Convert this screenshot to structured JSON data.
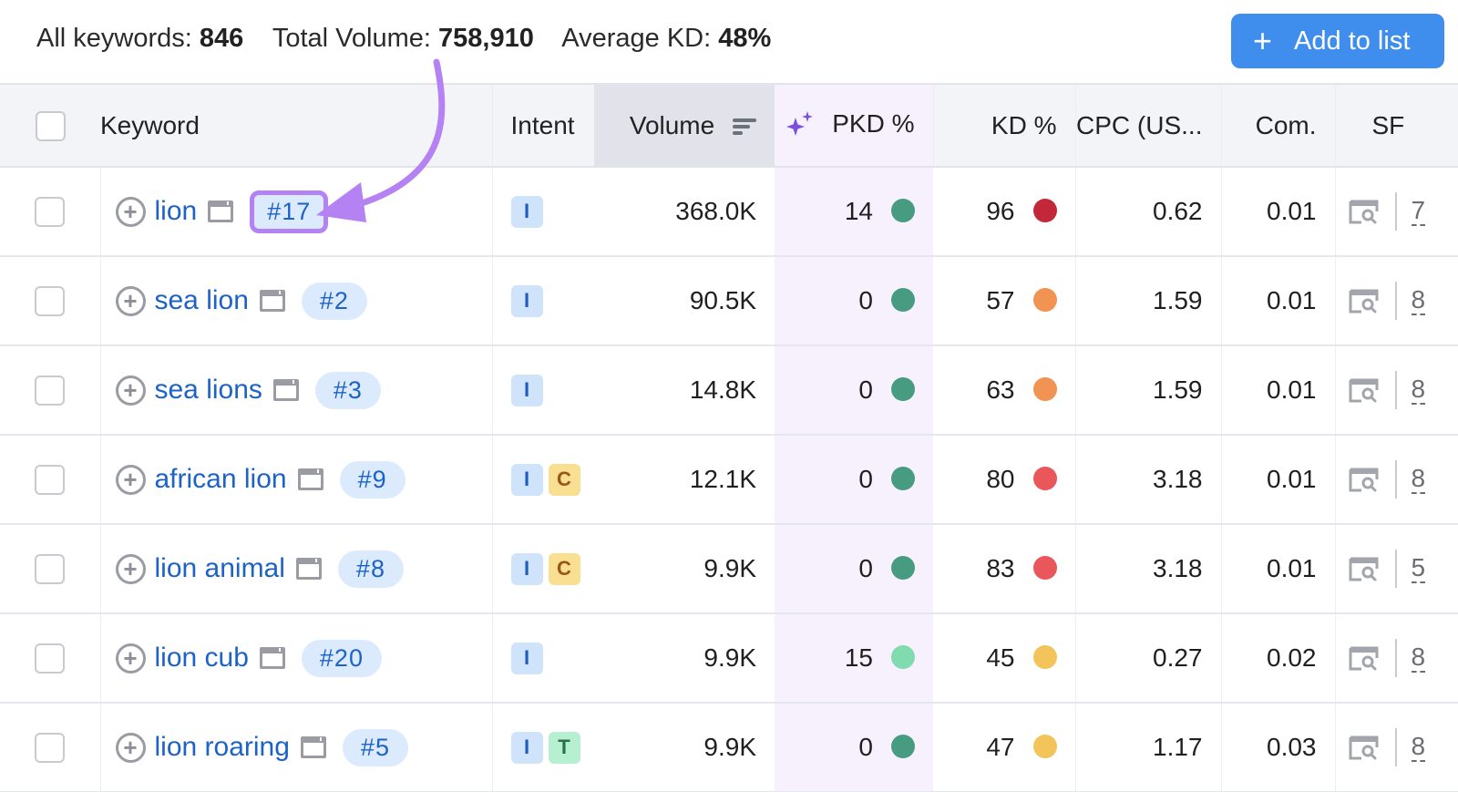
{
  "summary": {
    "all_keywords_label": "All keywords:",
    "all_keywords_value": "846",
    "total_volume_label": "Total Volume:",
    "total_volume_value": "758,910",
    "average_kd_label": "Average KD:",
    "average_kd_value": "48%"
  },
  "toolbar": {
    "add_to_list_icon": "plus-icon",
    "add_to_list_label": "Add to list",
    "accent_color": "#3f8ded"
  },
  "table": {
    "columns": {
      "keyword": "Keyword",
      "intent": "Intent",
      "volume": "Volume",
      "volume_sort_icon": "sort-descending-icon",
      "pkd": "PKD %",
      "pkd_icon": "sparkle-icon",
      "kd": "KD %",
      "cpc": "CPC (US...",
      "com": "Com.",
      "sf": "SF"
    },
    "rows": [
      {
        "keyword": "lion",
        "position": "#17",
        "highlighted": true,
        "intents": [
          "I"
        ],
        "volume": "368.0K",
        "pkd": "14",
        "pkd_color": "#479b80",
        "kd": "96",
        "kd_color": "#c2283a",
        "cpc": "0.62",
        "com": "0.01",
        "sf": "7"
      },
      {
        "keyword": "sea lion",
        "position": "#2",
        "highlighted": false,
        "intents": [
          "I"
        ],
        "volume": "90.5K",
        "pkd": "0",
        "pkd_color": "#479b80",
        "kd": "57",
        "kd_color": "#f09353",
        "cpc": "1.59",
        "com": "0.01",
        "sf": "8"
      },
      {
        "keyword": "sea lions",
        "position": "#3",
        "highlighted": false,
        "intents": [
          "I"
        ],
        "volume": "14.8K",
        "pkd": "0",
        "pkd_color": "#479b80",
        "kd": "63",
        "kd_color": "#f09353",
        "cpc": "1.59",
        "com": "0.01",
        "sf": "8"
      },
      {
        "keyword": "african lion",
        "position": "#9",
        "highlighted": false,
        "intents": [
          "I",
          "C"
        ],
        "volume": "12.1K",
        "pkd": "0",
        "pkd_color": "#479b80",
        "kd": "80",
        "kd_color": "#e9575a",
        "cpc": "3.18",
        "com": "0.01",
        "sf": "8"
      },
      {
        "keyword": "lion animal",
        "position": "#8",
        "highlighted": false,
        "intents": [
          "I",
          "C"
        ],
        "volume": "9.9K",
        "pkd": "0",
        "pkd_color": "#479b80",
        "kd": "83",
        "kd_color": "#e9575a",
        "cpc": "3.18",
        "com": "0.01",
        "sf": "5"
      },
      {
        "keyword": "lion cub",
        "position": "#20",
        "highlighted": false,
        "intents": [
          "I"
        ],
        "volume": "9.9K",
        "pkd": "15",
        "pkd_color": "#80dbaf",
        "kd": "45",
        "kd_color": "#f3c459",
        "cpc": "0.27",
        "com": "0.02",
        "sf": "8"
      },
      {
        "keyword": "lion roaring",
        "position": "#5",
        "highlighted": false,
        "intents": [
          "I",
          "T"
        ],
        "volume": "9.9K",
        "pkd": "0",
        "pkd_color": "#479b80",
        "kd": "47",
        "kd_color": "#f3c459",
        "cpc": "1.17",
        "com": "0.03",
        "sf": "8"
      }
    ]
  },
  "annotation": {
    "type": "curved-arrow",
    "color": "#b582f4",
    "points_to": "position badge #17"
  }
}
